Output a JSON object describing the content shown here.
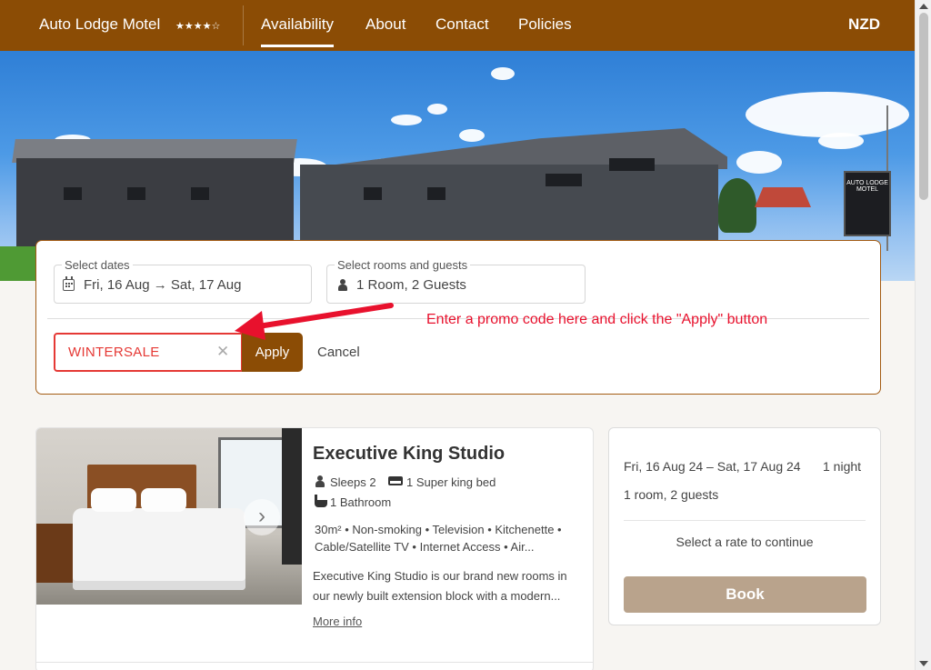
{
  "header": {
    "brand": "Auto Lodge Motel",
    "rating_stars": "★★★★☆",
    "nav": [
      {
        "label": "Availability",
        "active": true
      },
      {
        "label": "About"
      },
      {
        "label": "Contact"
      },
      {
        "label": "Policies"
      }
    ],
    "currency": "NZD"
  },
  "hero": {
    "sign_text": "AUTO LODGE MOTEL"
  },
  "search": {
    "dates_label": "Select dates",
    "dates_value": "Fri, 16 Aug → Sat, 17 Aug",
    "rooms_label": "Select rooms and guests",
    "rooms_value": "1 Room, 2 Guests",
    "promo_value": "WINTERSALE",
    "promo_clear": "✕",
    "apply_label": "Apply",
    "cancel_label": "Cancel"
  },
  "annotation": {
    "text": "Enter a promo code here and click the \"Apply\" button",
    "color": "#e8112d"
  },
  "room": {
    "title": "Executive King Studio",
    "sleeps": "Sleeps 2",
    "bed": "1 Super king bed",
    "bathroom": "1 Bathroom",
    "amenities": "30m² • Non-smoking • Television • Kitchenette • Cable/Satellite TV • Internet Access • Air...",
    "description": "Executive King Studio is our brand new rooms in our newly built extension block with a modern...",
    "more_info": "More info",
    "carousel_next": "›"
  },
  "summary": {
    "dates": "Fri, 16 Aug 24 – Sat, 17 Aug 24",
    "nights": "1 night",
    "guests": "1 room, 2 guests",
    "select_rate": "Select a rate to continue",
    "book_label": "Book"
  },
  "colors": {
    "brand": "#8b4c05",
    "accent_border": "#a35b13",
    "promo_red": "#e53935",
    "book_disabled": "#b9a38c"
  }
}
